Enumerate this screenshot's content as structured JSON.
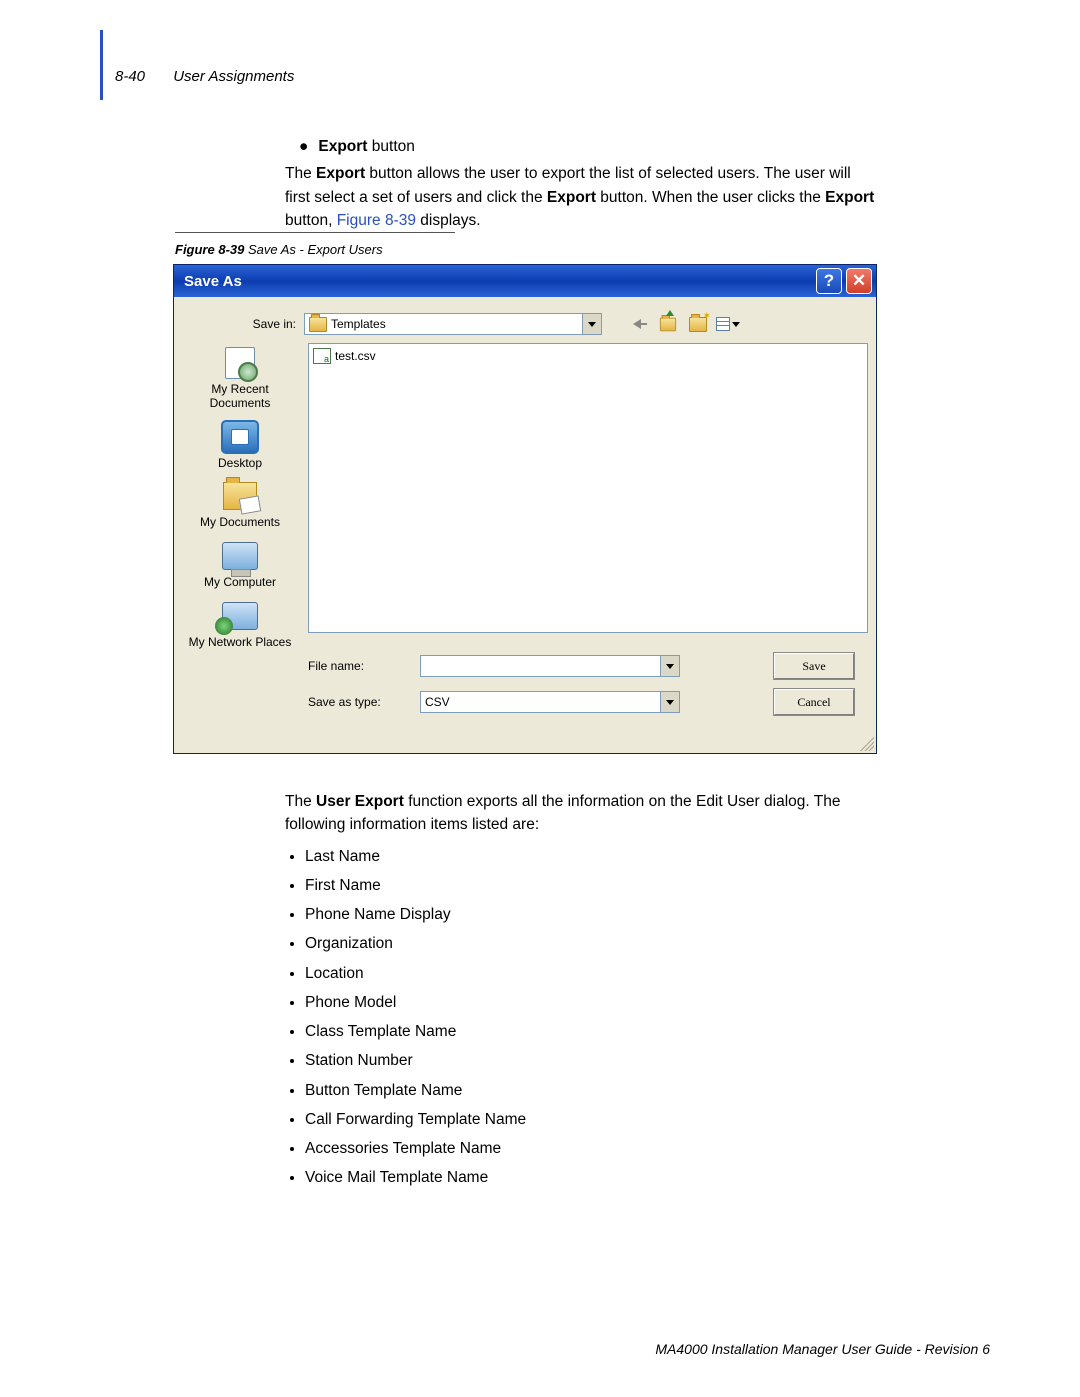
{
  "header": {
    "page_num": "8-40",
    "section": "User Assignments"
  },
  "intro": {
    "bullet_label_bold": "Export",
    "bullet_label_rest": " button",
    "p1a": "The ",
    "p1b": "Export",
    "p1c": " button allows the user to export the list of selected users. The user will first select a set of users and click the ",
    "p1d": "Export",
    "p1e": " button. When the user clicks the ",
    "p1f": "Export",
    "p1g": " button, ",
    "figref": "Figure 8-39",
    "p1h": " displays."
  },
  "figure_caption": {
    "prefix": "Figure 8-39",
    "title": "  Save As - Export Users"
  },
  "dialog": {
    "title": "Save As",
    "save_in_label": "Save in:",
    "save_in_value": "Templates",
    "file_list": [
      "test.csv"
    ],
    "places": [
      "My Recent Documents",
      "Desktop",
      "My Documents",
      "My Computer",
      "My Network Places"
    ],
    "file_name_label": "File name:",
    "file_name_value": "",
    "save_as_type_label": "Save as type:",
    "save_as_type_value": "CSV",
    "save_btn": "Save",
    "cancel_btn": "Cancel"
  },
  "after": {
    "p2a": "The ",
    "p2b": "User Export",
    "p2c": " function exports all the information on the Edit User dialog. The following information items listed are:",
    "items": [
      "Last Name",
      "First Name",
      "Phone Name Display",
      "Organization",
      "Location",
      "Phone Model",
      "Class Template Name",
      "Station Number",
      "Button Template Name",
      "Call Forwarding Template Name",
      "Accessories Template Name",
      "Voice Mail Template Name"
    ]
  },
  "footer": "MA4000 Installation Manager User Guide - Revision 6"
}
